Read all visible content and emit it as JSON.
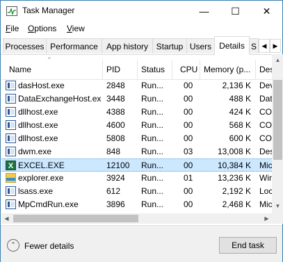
{
  "window": {
    "title": "Task Manager"
  },
  "menu": [
    {
      "label": "File",
      "mnemonic": "F",
      "rest": "ile"
    },
    {
      "label": "Options",
      "mnemonic": "O",
      "rest": "ptions"
    },
    {
      "label": "View",
      "mnemonic": "V",
      "rest": "iew"
    }
  ],
  "tabs": [
    "Processes",
    "Performance",
    "App history",
    "Startup",
    "Users",
    "Details",
    "S"
  ],
  "active_tab": "Details",
  "columns": [
    "Name",
    "PID",
    "Status",
    "CPU",
    "Memory (p...",
    "Des"
  ],
  "rows": [
    {
      "icon": "window-app-icon",
      "name": "dasHost.exe",
      "pid": "2848",
      "status": "Run...",
      "cpu": "00",
      "memory": "2,136 K",
      "desc": "Dev"
    },
    {
      "icon": "window-app-icon",
      "name": "DataExchangeHost.exe",
      "pid": "3448",
      "status": "Run...",
      "cpu": "00",
      "memory": "488 K",
      "desc": "Dat"
    },
    {
      "icon": "window-app-icon",
      "name": "dllhost.exe",
      "pid": "4388",
      "status": "Run...",
      "cpu": "00",
      "memory": "424 K",
      "desc": "COI"
    },
    {
      "icon": "window-app-icon",
      "name": "dllhost.exe",
      "pid": "4600",
      "status": "Run...",
      "cpu": "00",
      "memory": "568 K",
      "desc": "COI"
    },
    {
      "icon": "window-app-icon",
      "name": "dllhost.exe",
      "pid": "5808",
      "status": "Run...",
      "cpu": "00",
      "memory": "600 K",
      "desc": "COI"
    },
    {
      "icon": "window-app-icon",
      "name": "dwm.exe",
      "pid": "848",
      "status": "Run...",
      "cpu": "03",
      "memory": "13,008 K",
      "desc": "Des"
    },
    {
      "icon": "excel-icon",
      "name": "EXCEL.EXE",
      "pid": "12100",
      "status": "Run...",
      "cpu": "00",
      "memory": "10,384 K",
      "desc": "Mic",
      "selected": true
    },
    {
      "icon": "explorer-icon",
      "name": "explorer.exe",
      "pid": "3924",
      "status": "Run...",
      "cpu": "01",
      "memory": "13,236 K",
      "desc": "Win"
    },
    {
      "icon": "window-app-icon",
      "name": "lsass.exe",
      "pid": "612",
      "status": "Run...",
      "cpu": "00",
      "memory": "2,192 K",
      "desc": "Loc"
    },
    {
      "icon": "window-app-icon",
      "name": "MpCmdRun.exe",
      "pid": "3896",
      "status": "Run...",
      "cpu": "00",
      "memory": "2,468 K",
      "desc": "Mic"
    }
  ],
  "footer": {
    "fewer_details": "Fewer details",
    "end_task": "End task"
  }
}
